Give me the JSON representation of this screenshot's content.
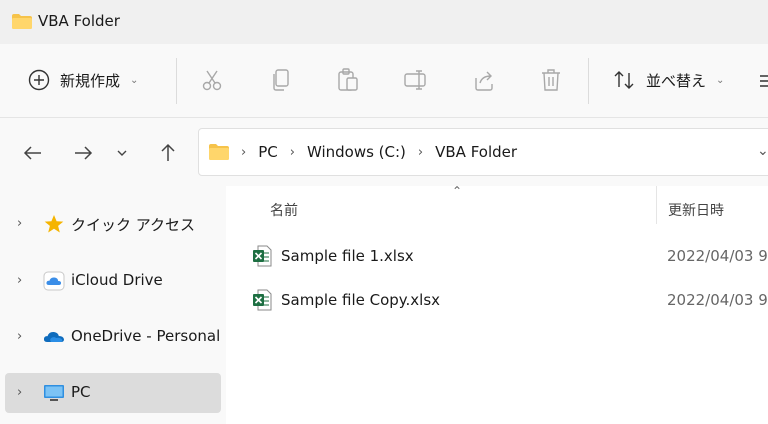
{
  "window": {
    "title": "VBA Folder"
  },
  "toolbar": {
    "new_label": "新規作成",
    "new_icon": "plus-circle-icon",
    "sort_label": "並べ替え",
    "sort_icon": "sort-icon",
    "actions": [
      "cut-icon",
      "copy-icon",
      "paste-icon",
      "rename-icon",
      "share-icon",
      "delete-icon"
    ]
  },
  "address": {
    "crumbs": [
      "PC",
      "Windows (C:)",
      "VBA Folder"
    ]
  },
  "sidebar": {
    "items": [
      {
        "label": "クイック アクセス",
        "icon": "star-icon"
      },
      {
        "label": "iCloud Drive",
        "icon": "icloud-icon"
      },
      {
        "label": "OneDrive - Personal",
        "icon": "onedrive-icon"
      },
      {
        "label": "PC",
        "icon": "pc-icon",
        "selected": true
      }
    ]
  },
  "columns": {
    "name": "名前",
    "date": "更新日時"
  },
  "files": [
    {
      "name": "Sample file 1.xlsx",
      "date": "2022/04/03 9",
      "icon": "excel-file-icon"
    },
    {
      "name": "Sample file Copy.xlsx",
      "date": "2022/04/03 9",
      "icon": "excel-file-icon"
    }
  ],
  "colors": {
    "folder": "#f6c34a",
    "excel": "#1d6f42",
    "star": "#f5b400",
    "cloud": "#1a73e8",
    "selected": "#dcdcdc"
  }
}
